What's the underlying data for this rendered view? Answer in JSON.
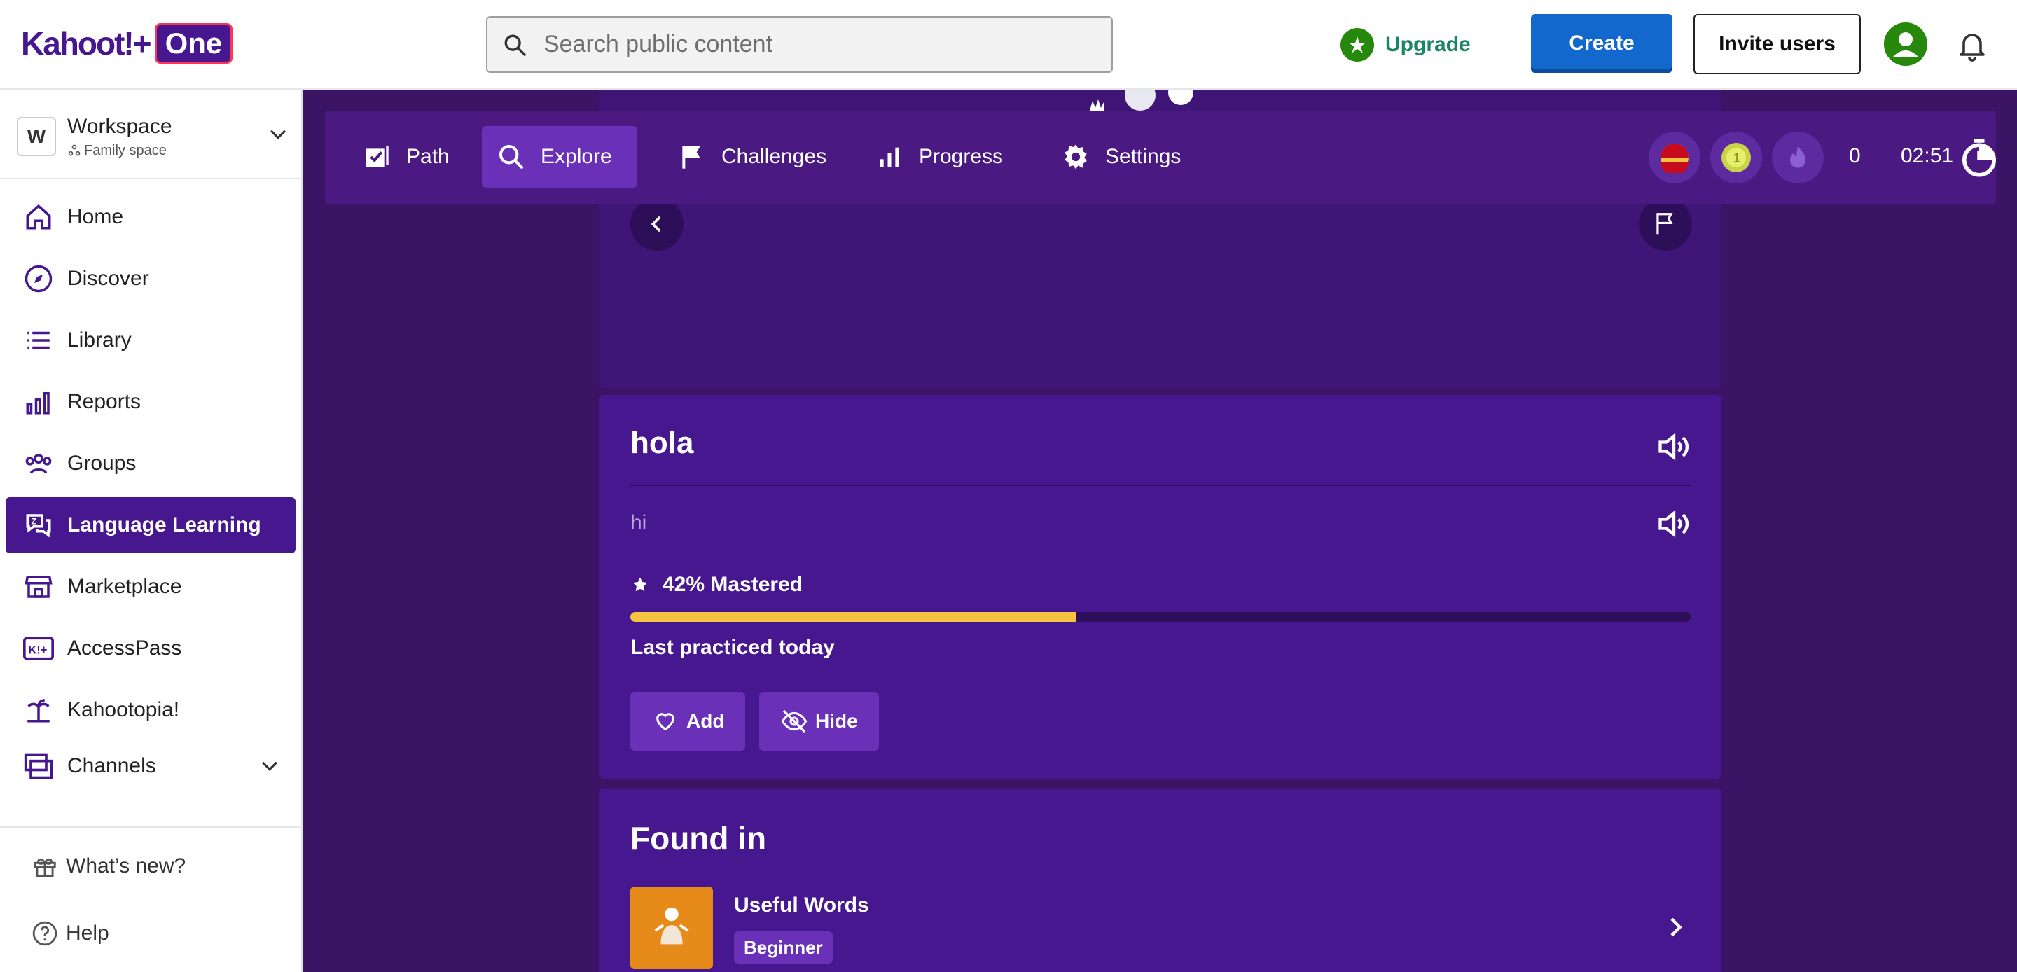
{
  "app": {
    "logo_text": "Kahoot!+",
    "logo_badge": "One"
  },
  "topbar": {
    "search_placeholder": "Search public content",
    "upgrade_label": "Upgrade",
    "create_label": "Create",
    "invite_label": "Invite users"
  },
  "sidebar": {
    "workspace": {
      "badge": "W",
      "name": "Workspace",
      "sub": "Family space"
    },
    "items": [
      {
        "label": "Home",
        "icon": "home-icon"
      },
      {
        "label": "Discover",
        "icon": "compass-icon"
      },
      {
        "label": "Library",
        "icon": "list-icon"
      },
      {
        "label": "Reports",
        "icon": "bar-chart-icon"
      },
      {
        "label": "Groups",
        "icon": "group-icon"
      },
      {
        "label": "Language Learning",
        "icon": "language-icon",
        "active": true
      },
      {
        "label": "Marketplace",
        "icon": "store-icon"
      },
      {
        "label": "AccessPass",
        "icon": "accesspass-icon"
      },
      {
        "label": "Kahootopia!",
        "icon": "island-icon"
      },
      {
        "label": "Channels",
        "icon": "channels-icon"
      }
    ],
    "footer": [
      {
        "label": "What’s new?",
        "icon": "gift-icon"
      },
      {
        "label": "Help",
        "icon": "help-icon"
      }
    ]
  },
  "lang_nav": {
    "items": [
      {
        "label": "Path",
        "icon": "path-check-icon"
      },
      {
        "label": "Explore",
        "icon": "search-icon",
        "active": true
      },
      {
        "label": "Challenges",
        "icon": "flag-icon"
      },
      {
        "label": "Progress",
        "icon": "progress-bars-icon"
      },
      {
        "label": "Settings",
        "icon": "gear-icon"
      }
    ],
    "streak_count": "0",
    "timer": "02:51"
  },
  "card": {
    "word": "hola",
    "translation": "hi",
    "mastery_label": "42% Mastered",
    "mastery_fraction": 0.42,
    "last_practiced": "Last practiced today",
    "add_label": "Add",
    "hide_label": "Hide"
  },
  "found_in": {
    "title": "Found in",
    "course_name": "Useful Words",
    "course_level": "Beginner"
  },
  "colors": {
    "brand": "#46178f",
    "accent_blue": "#1368ce",
    "upgrade_green": "#26890c",
    "progress_yellow": "#f5c542",
    "course_orange": "#e68a1a"
  }
}
